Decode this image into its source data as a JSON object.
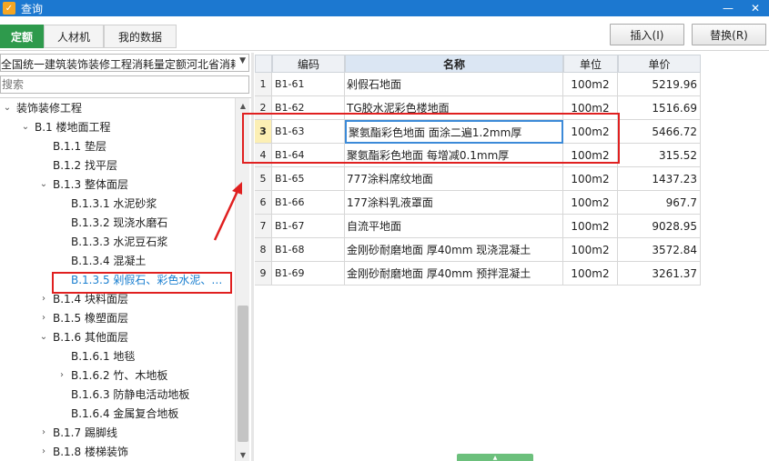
{
  "window": {
    "title": "查询",
    "app_icon_glyph": "✓",
    "minimize_glyph": "—",
    "close_glyph": "✕"
  },
  "tabs": [
    {
      "label": "定额",
      "active": true
    },
    {
      "label": "人材机",
      "active": false
    },
    {
      "label": "我的数据",
      "active": false
    }
  ],
  "toolbar": {
    "insert_label": "插入(I)",
    "replace_label": "替换(R)"
  },
  "left": {
    "combo_value": "全国统一建筑装饰装修工程消耗量定额河北省消耗",
    "search_placeholder": "搜索",
    "tree": [
      {
        "label": "装饰装修工程",
        "toggle": "⌄"
      },
      {
        "label": "B.1  楼地面工程",
        "toggle": "⌄"
      },
      {
        "label": "B.1.1  垫层",
        "toggle": ""
      },
      {
        "label": "B.1.2  找平层",
        "toggle": ""
      },
      {
        "label": "B.1.3  整体面层",
        "toggle": "⌄"
      },
      {
        "label": "B.1.3.1  水泥砂浆",
        "toggle": ""
      },
      {
        "label": "B.1.3.2  现浇水磨石",
        "toggle": ""
      },
      {
        "label": "B.1.3.3  水泥豆石浆",
        "toggle": ""
      },
      {
        "label": "B.1.3.4  混凝土",
        "toggle": ""
      },
      {
        "label": "B.1.3.5  剁假石、彩色水泥、…",
        "toggle": "",
        "selected": true
      },
      {
        "label": "B.1.4  块料面层",
        "toggle": "›"
      },
      {
        "label": "B.1.5  橡塑面层",
        "toggle": "›"
      },
      {
        "label": "B.1.6  其他面层",
        "toggle": "⌄"
      },
      {
        "label": "B.1.6.1  地毯",
        "toggle": ""
      },
      {
        "label": "B.1.6.2  竹、木地板",
        "toggle": "›"
      },
      {
        "label": "B.1.6.3  防静电活动地板",
        "toggle": ""
      },
      {
        "label": "B.1.6.4  金属复合地板",
        "toggle": ""
      },
      {
        "label": "B.1.7  踢脚线",
        "toggle": "›"
      },
      {
        "label": "B.1.8  楼梯装饰",
        "toggle": "›"
      }
    ]
  },
  "grid": {
    "columns": [
      "",
      "编码",
      "名称",
      "单位",
      "单价"
    ],
    "rows": [
      {
        "num": "1",
        "code": "B1-61",
        "name": "剁假石地面",
        "unit": "100m2",
        "price": "5219.96"
      },
      {
        "num": "2",
        "code": "B1-62",
        "name": "TG胶水泥彩色楼地面",
        "unit": "100m2",
        "price": "1516.69"
      },
      {
        "num": "3",
        "code": "B1-63",
        "name": "聚氨酯彩色地面 面涂二遍1.2mm厚",
        "unit": "100m2",
        "price": "5466.72"
      },
      {
        "num": "4",
        "code": "B1-64",
        "name": "聚氨酯彩色地面 每增减0.1mm厚",
        "unit": "100m2",
        "price": "315.52"
      },
      {
        "num": "5",
        "code": "B1-65",
        "name": "777涂料席纹地面",
        "unit": "100m2",
        "price": "1437.23"
      },
      {
        "num": "6",
        "code": "B1-66",
        "name": "177涂料乳液罩面",
        "unit": "100m2",
        "price": "967.7"
      },
      {
        "num": "7",
        "code": "B1-67",
        "name": "自流平地面",
        "unit": "100m2",
        "price": "9028.95"
      },
      {
        "num": "8",
        "code": "B1-68",
        "name": "金刚砂耐磨地面 厚40mm 现浇混凝土",
        "unit": "100m2",
        "price": "3572.84"
      },
      {
        "num": "9",
        "code": "B1-69",
        "name": "金刚砂耐磨地面 厚40mm 预拌混凝土",
        "unit": "100m2",
        "price": "3261.37"
      }
    ]
  },
  "colors": {
    "titlebar": "#1c78d0",
    "active_tab": "#2e9a4c",
    "annotation": "#e02020",
    "selected_text": "#1a7fd0"
  },
  "icons": [
    "app-icon",
    "minimize-icon",
    "close-icon",
    "scroll-up-icon",
    "scroll-down-icon",
    "dropdown-arrow-icon",
    "expand-icon",
    "collapse-icon",
    "annotation-arrow",
    "splitter-grip-icon"
  ]
}
